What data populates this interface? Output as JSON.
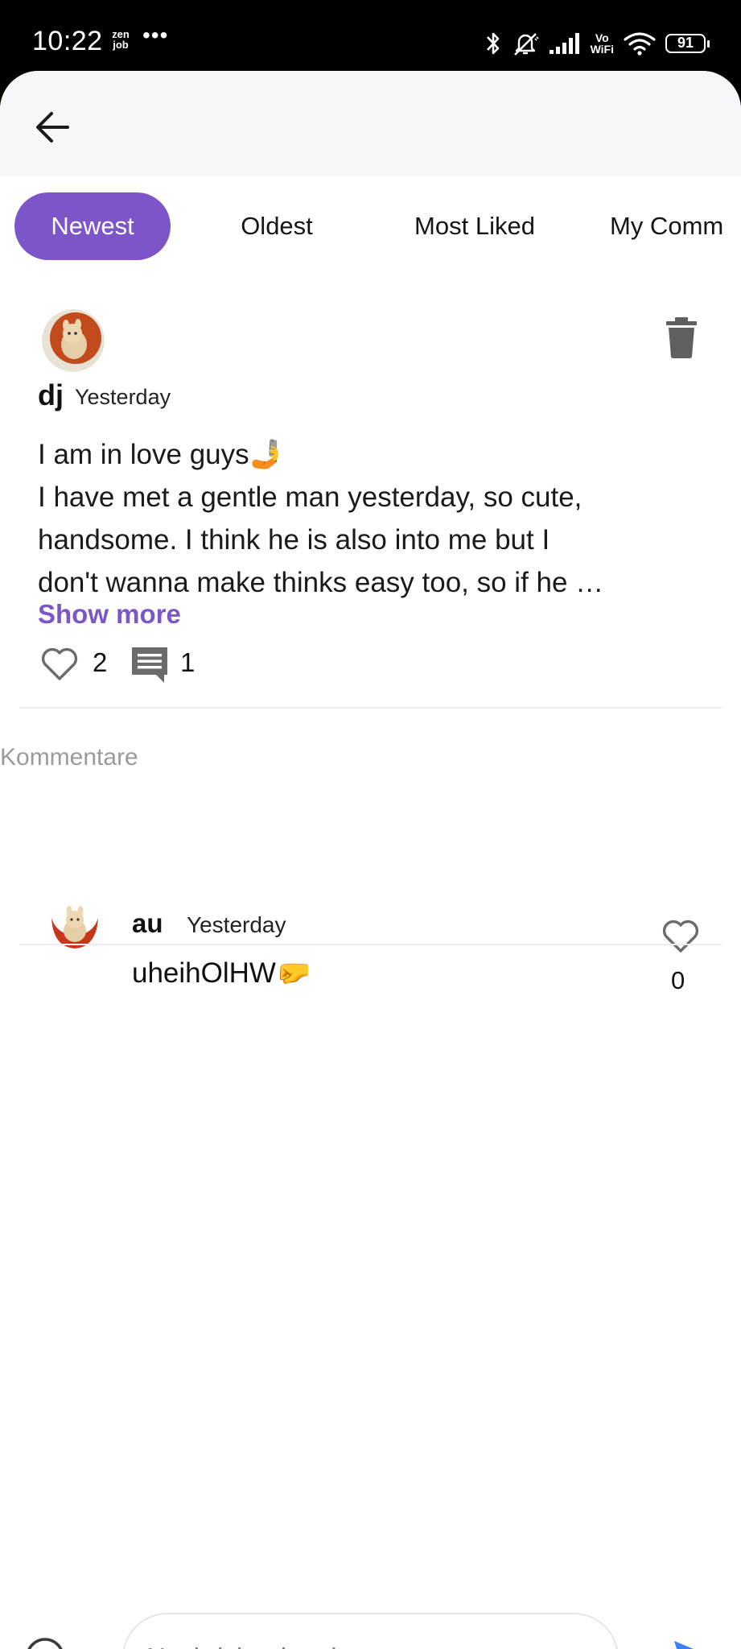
{
  "status_bar": {
    "time": "10:22",
    "app_badge_top": "zen",
    "app_badge_bottom": "job",
    "more": "•••",
    "vowifi_top": "Vo",
    "vowifi_bottom": "WiFi",
    "battery": "91"
  },
  "tabs": [
    {
      "label": "Newest",
      "active": true
    },
    {
      "label": "Oldest",
      "active": false
    },
    {
      "label": "Most Liked",
      "active": false
    },
    {
      "label": "My Comm",
      "active": false
    }
  ],
  "post": {
    "author": "dj",
    "time": "Yesterday",
    "lines": [
      "I am in love guys🤳",
      "I have met a gentle man yesterday, so cute,",
      "handsome. I think he is also into me but I",
      "don't wanna make thinks easy too, so if he …"
    ],
    "show_more": "Show more",
    "likes": "2",
    "comments": "1"
  },
  "comments_section": {
    "label": "Kommentare",
    "items": [
      {
        "author": "au",
        "time": "Yesterday",
        "text": "uheihOlHW🤛",
        "likes": "0"
      }
    ]
  },
  "composer": {
    "placeholder": "Nachricht eingeben..."
  },
  "colors": {
    "accent": "#7c55c8",
    "send": "#3b82f6"
  }
}
